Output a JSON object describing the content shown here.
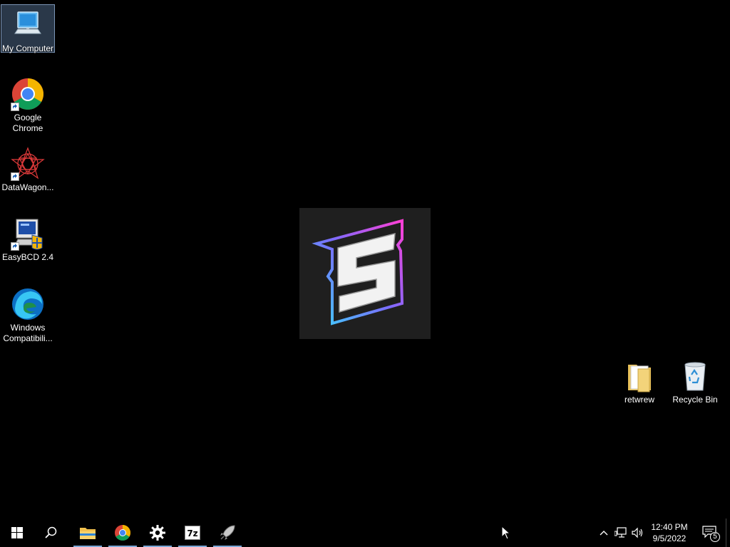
{
  "desktop": {
    "icons_left": [
      {
        "label": "My Computer"
      },
      {
        "label": "Google Chrome"
      },
      {
        "label": "DataWagon..."
      },
      {
        "label": "EasyBCD 2.4"
      },
      {
        "label": "Windows Compatibili..."
      }
    ],
    "icons_right": [
      {
        "label": "retwrew"
      },
      {
        "label": "Recycle Bin"
      }
    ],
    "wallpaper_logo": "5"
  },
  "taskbar": {
    "start_icon": "windows-logo",
    "search_icon": "search",
    "pinned": [
      {
        "name": "File Explorer",
        "icon": "folder-icon"
      },
      {
        "name": "Google Chrome",
        "icon": "chrome-icon"
      },
      {
        "name": "Settings",
        "icon": "gear-icon"
      },
      {
        "name": "7-Zip",
        "icon": "7z-icon",
        "text": "7z"
      },
      {
        "name": "App",
        "icon": "rocket-icon"
      }
    ],
    "tray": {
      "time": "12:40 PM",
      "date": "9/5/2022",
      "notification_count": "5"
    }
  }
}
